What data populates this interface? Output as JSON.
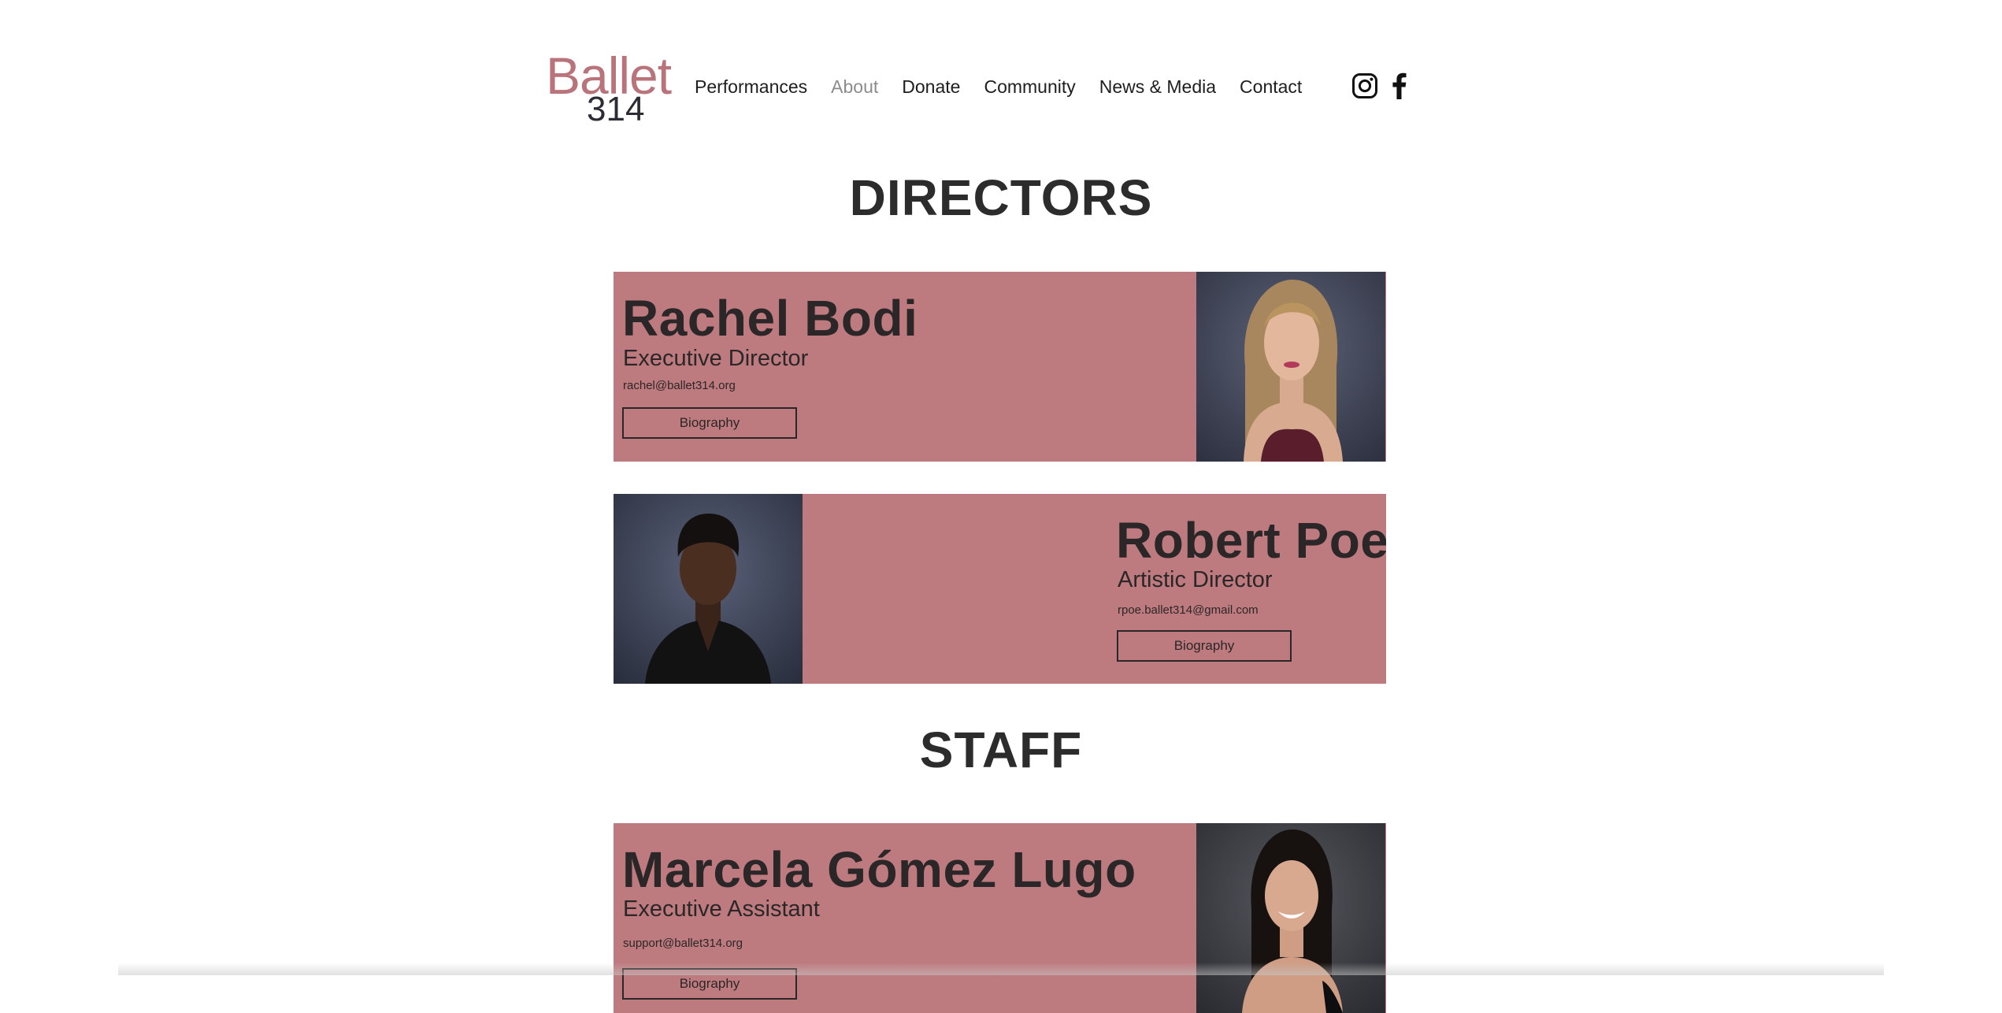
{
  "logo": {
    "line1": "Ballet",
    "line2": "314"
  },
  "nav": {
    "items": [
      {
        "label": "Performances"
      },
      {
        "label": "About"
      },
      {
        "label": "Donate"
      },
      {
        "label": "Community"
      },
      {
        "label": "News & Media"
      },
      {
        "label": "Contact"
      }
    ],
    "active": "About"
  },
  "social": {
    "icons": [
      "instagram-icon",
      "facebook-icon"
    ]
  },
  "sections": {
    "directors_title": "DIRECTORS",
    "staff_title": "STAFF"
  },
  "people": {
    "rachel": {
      "name": "Rachel Bodi",
      "role": "Executive Director",
      "email": "rachel@ballet314.org",
      "button": "Biography"
    },
    "robert": {
      "name": "Robert Poe",
      "role": "Artistic Director",
      "email": "rpoe.ballet314@gmail.com",
      "button": "Biography"
    },
    "marcela": {
      "name": "Marcela Gómez Lugo",
      "role": "Executive Assistant",
      "email": "support@ballet314.org",
      "button": "Biography"
    }
  },
  "colors": {
    "brand_pink": "#b9747b",
    "card_bg": "#be7b7f",
    "text_dark": "#2b2627",
    "nav_active": "#8c8c8c"
  }
}
